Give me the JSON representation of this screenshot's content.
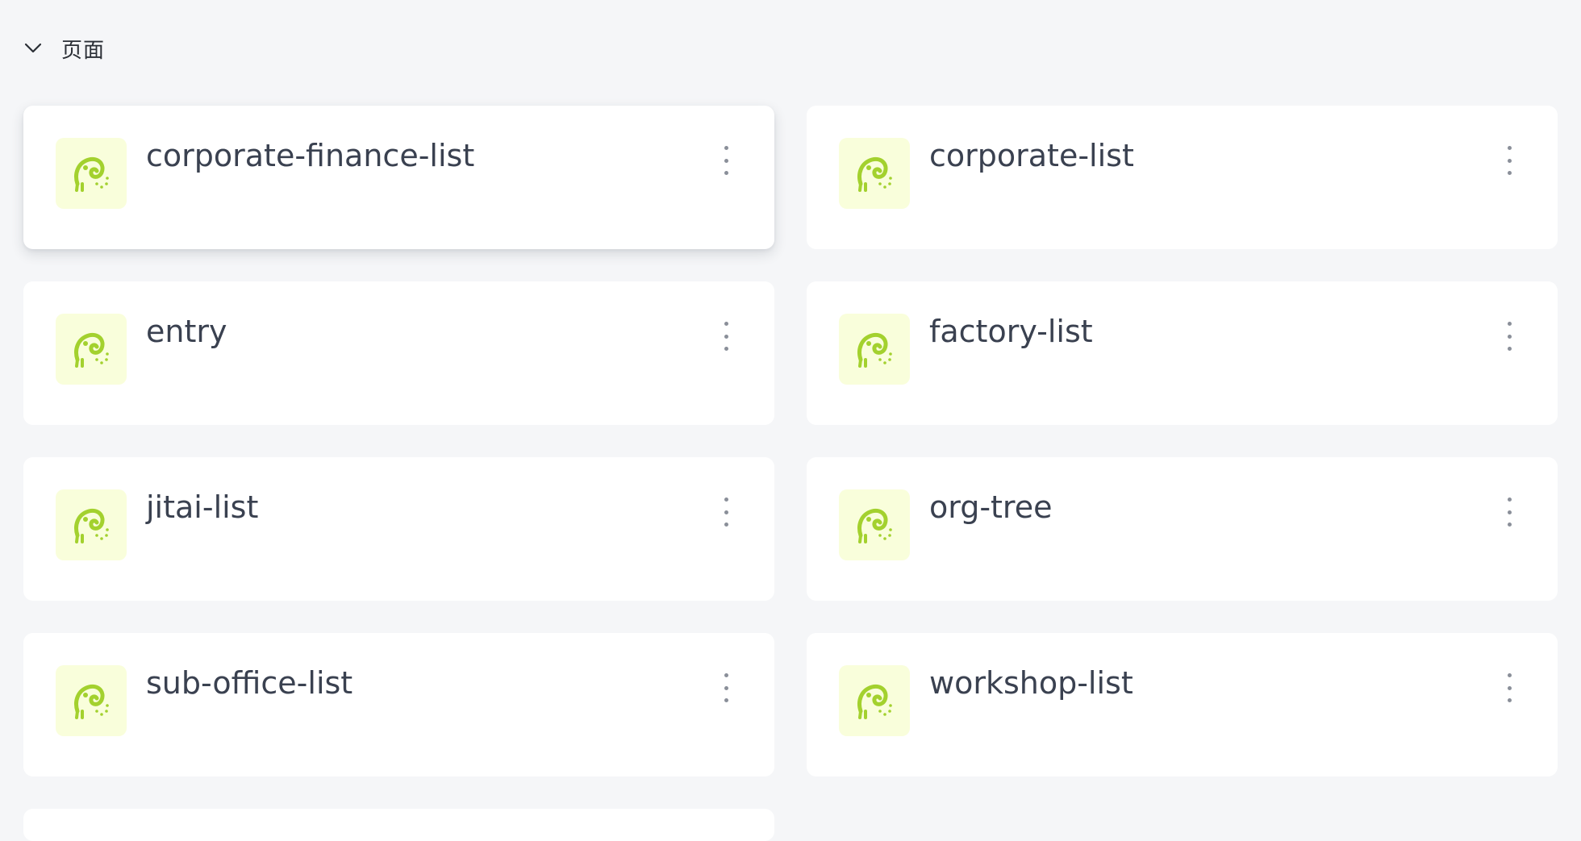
{
  "section": {
    "title": "页面",
    "expanded": true
  },
  "colors": {
    "background": "#f5f6f8",
    "card": "#ffffff",
    "icon_bg": "#f9fedb",
    "icon_fg": "#a3d12e",
    "title_text": "#3a4150"
  },
  "pages": [
    {
      "name": "corporate-finance-list",
      "icon": "chameleon-icon"
    },
    {
      "name": "corporate-list",
      "icon": "chameleon-icon"
    },
    {
      "name": "entry",
      "icon": "chameleon-icon"
    },
    {
      "name": "factory-list",
      "icon": "chameleon-icon"
    },
    {
      "name": "jitai-list",
      "icon": "chameleon-icon"
    },
    {
      "name": "org-tree",
      "icon": "chameleon-icon"
    },
    {
      "name": "sub-office-list",
      "icon": "chameleon-icon"
    },
    {
      "name": "workshop-list",
      "icon": "chameleon-icon"
    }
  ]
}
